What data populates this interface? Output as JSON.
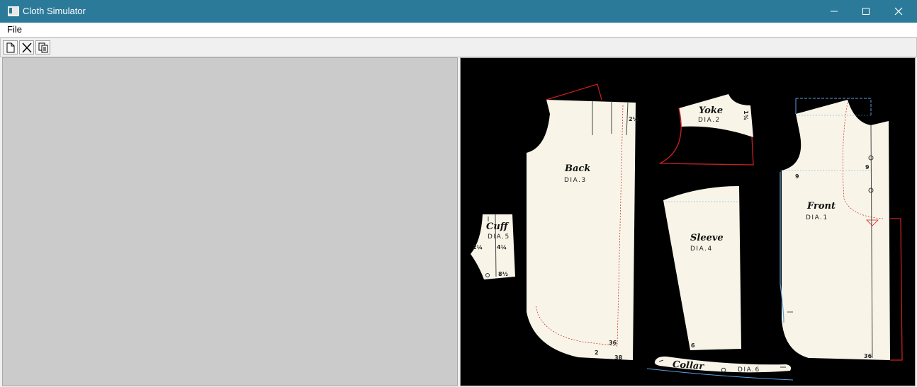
{
  "window": {
    "title": "Cloth Simulator",
    "controls": [
      "minimize-icon",
      "maximize-icon",
      "close-icon"
    ]
  },
  "menu": {
    "items": [
      {
        "label": "File"
      }
    ]
  },
  "toolbar": {
    "buttons": [
      "new-document-icon",
      "delete-icon",
      "copy-icon"
    ]
  },
  "pattern": {
    "pieces": [
      {
        "name": "Back",
        "code": "DIA.3",
        "labels": [
          "2½",
          "36",
          "2",
          "38"
        ]
      },
      {
        "name": "Yoke",
        "code": "DIA.2",
        "labels": [
          "1¾"
        ]
      },
      {
        "name": "Front",
        "code": "DIA.1",
        "labels": [
          "9",
          "9",
          "36"
        ]
      },
      {
        "name": "Cuff",
        "code": "DIA.5",
        "labels": [
          "2¼",
          "4¼",
          "8½"
        ]
      },
      {
        "name": "Sleeve",
        "code": "DIA.4",
        "labels": [
          "6"
        ]
      },
      {
        "name": "Collar",
        "code": "DIA.6",
        "labels": []
      }
    ]
  },
  "colors": {
    "titlebar": "#2b7a99",
    "fabric": "#f8f5e8",
    "seam": "#cc2020",
    "guide": "#5aa0e0",
    "canvas": "#000000",
    "viewport": "#cbcbcb"
  }
}
